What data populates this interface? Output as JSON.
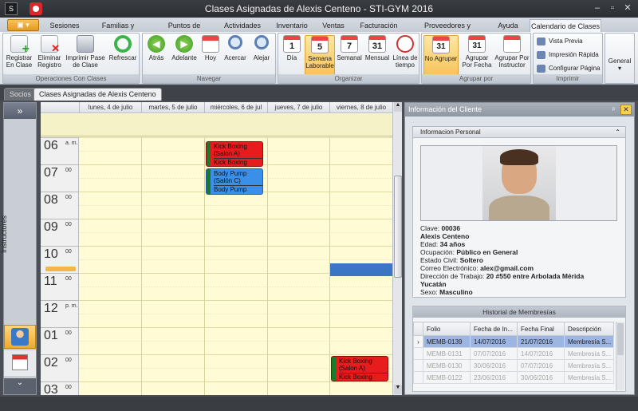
{
  "window": {
    "title": "Clases Asignadas de Alexis Centeno - STI-GYM 2016"
  },
  "ribbon_tabs": [
    "Sesiones",
    "Familias y Socios",
    "Puntos de Acceso",
    "Actividades",
    "Inventario",
    "Ventas",
    "Facturación",
    "Proveedores y Compras",
    "Ayuda",
    "Calendario de Clases"
  ],
  "groups": {
    "operaciones": {
      "label": "Operaciones Con Clases",
      "registrar": "Registrar En Clase",
      "eliminar": "Eliminar Registro",
      "imprimir": "Imprimir Pase de Clase",
      "refrescar": "Refrescar"
    },
    "navegar": {
      "label": "Navegar",
      "atras": "Atrás",
      "adelante": "Adelante",
      "hoy": "Hoy",
      "acercar": "Acercar",
      "alejar": "Alejar"
    },
    "organizar": {
      "label": "Organizar",
      "dia": "Día",
      "semana_lab": "Semana Laborable",
      "semanal": "Semanal",
      "mensual": "Mensual",
      "linea": "Línea de tiempo"
    },
    "agrupar": {
      "label": "Agrupar por",
      "no_agrupar": "No Agrupar",
      "por_fecha": "Agrupar Por Fecha",
      "por_instructor": "Agrupar Por Instructor"
    },
    "imprimir": {
      "label": "Imprimir",
      "vista": "Vista Previa",
      "rapida": "Impresión Rápida",
      "config": "Configurar Página"
    },
    "general": {
      "label": "General"
    }
  },
  "icon_numbers": {
    "dia": "1",
    "semana": "5",
    "semanal": "7",
    "mensual": "31",
    "no_agrupar": "31",
    "por_fecha": "31"
  },
  "doc_tabs": [
    "Socios",
    "Clases Asignadas de Alexis Centeno"
  ],
  "sidebar": {
    "label": "Instructores",
    "collapse": "»",
    "scroll": "⌄"
  },
  "calendar": {
    "days": [
      "lunes, 4 de julio",
      "martes, 5 de julio",
      "miércoles, 6 de jul",
      "jueves, 7 de julio",
      "viernes, 8 de julio"
    ],
    "hours": [
      {
        "h": "06",
        "m": "a. m."
      },
      {
        "h": "07",
        "m": "00"
      },
      {
        "h": "08",
        "m": "00"
      },
      {
        "h": "09",
        "m": "00"
      },
      {
        "h": "10",
        "m": "00"
      },
      {
        "h": "11",
        "m": "00"
      },
      {
        "h": "12",
        "m": "p. m."
      },
      {
        "h": "01",
        "m": "00"
      },
      {
        "h": "02",
        "m": "00"
      },
      {
        "h": "03",
        "m": "00"
      }
    ],
    "appointments": [
      {
        "title": "Kick Boxing (Salon A)",
        "sub": "Kick Boxing"
      },
      {
        "title": "Body Pump (Salón C)",
        "sub": "Body Pump"
      },
      {
        "title": "Kick Boxing (Salon A)",
        "sub": "Kick Boxing"
      }
    ]
  },
  "panel": {
    "title": "Información del Cliente",
    "close": "✕",
    "pin": "ᵖ",
    "personal_header": "Informacion Personal",
    "fields": [
      {
        "label": "Clave:",
        "value": "00036"
      },
      {
        "label": "",
        "value": "Alexis Centeno"
      },
      {
        "label": "Edad:",
        "value": "34 años"
      },
      {
        "label": "Ocupación:",
        "value": "Público en General"
      },
      {
        "label": "Estado Civil:",
        "value": "Soltero"
      },
      {
        "label": "Correo Electrónico:",
        "value": "alex@gmail.com"
      },
      {
        "label": "Dirección de Trabajo:",
        "value": "20 #550 entre  Arbolada Mérida"
      },
      {
        "label": "",
        "value": "Yucatán"
      },
      {
        "label": "Sexo:",
        "value": "Masculino"
      }
    ],
    "history_header": "Historial de Membresías",
    "columns": [
      "Folio",
      "Fecha de In...",
      "Fecha Final",
      "Descripción"
    ],
    "rows": [
      [
        "MEMB-0139",
        "14/07/2016",
        "21/07/2016",
        "Membresía S..."
      ],
      [
        "MEMB-0131",
        "07/07/2016",
        "14/07/2016",
        "Membresía S..."
      ],
      [
        "MEMB-0130",
        "30/06/2016",
        "07/07/2016",
        "Membresía S..."
      ],
      [
        "MEMB-0122",
        "23/06/2016",
        "30/06/2016",
        "Membresía S..."
      ]
    ]
  },
  "colors": {
    "red_appt": "#e81c1c",
    "blue_appt": "#3a8fe8",
    "accent": "#f6c55c",
    "selection": "#3a76c4"
  }
}
